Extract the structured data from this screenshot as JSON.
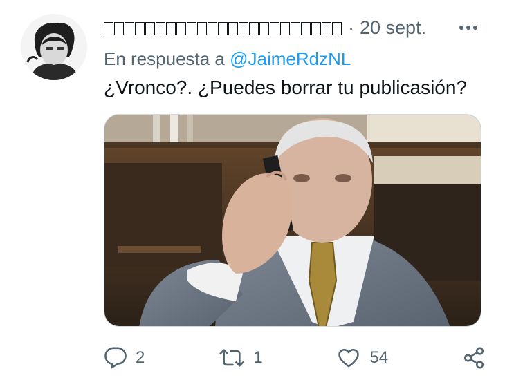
{
  "tweet": {
    "author_name_placeholder_count": 23,
    "date": "20 sept.",
    "separator": "·",
    "reply_prefix": "En respuesta a",
    "reply_handle": "@JaimeRdzNL",
    "text": "¿Vronco?.  ¿Puedes borrar tu publicasión?"
  },
  "actions": {
    "reply_count": "2",
    "retweet_count": "1",
    "like_count": "54"
  },
  "colors": {
    "link": "#1d9bf0",
    "muted": "#536471",
    "text": "#0f1419"
  }
}
